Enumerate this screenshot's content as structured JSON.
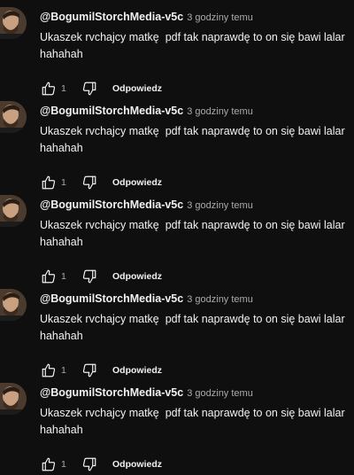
{
  "comments": [
    {
      "author": "@BogumilStorchMedia-v5c",
      "time": "3 godziny temu",
      "text_line1": "Ukaszek rvchajcy matkę  pdf tak naprawdę to on się bawi lalar",
      "text_line2": "hahahah",
      "like_count": "1",
      "reply_label": "Odpowiedz"
    },
    {
      "author": "@BogumilStorchMedia-v5c",
      "time": "3 godziny temu",
      "text_line1": "Ukaszek rvchajcy matkę  pdf tak naprawdę to on się bawi lalar",
      "text_line2": "hahahah",
      "like_count": "1",
      "reply_label": "Odpowiedz"
    },
    {
      "author": "@BogumilStorchMedia-v5c",
      "time": "3 godziny temu",
      "text_line1": "Ukaszek rvchajcy matkę  pdf tak naprawdę to on się bawi lalar",
      "text_line2": "hahahah",
      "like_count": "1",
      "reply_label": "Odpowiedz"
    },
    {
      "author": "@BogumilStorchMedia-v5c",
      "time": "3 godziny temu",
      "text_line1": "Ukaszek rvchajcy matkę  pdf tak naprawdę to on się bawi lalar",
      "text_line2": "hahahah",
      "like_count": "1",
      "reply_label": "Odpowiedz"
    },
    {
      "author": "@BogumilStorchMedia-v5c",
      "time": "3 godziny temu",
      "text_line1": "Ukaszek rvchajcy matkę  pdf tak naprawdę to on się bawi lalar",
      "text_line2": "hahahah",
      "like_count": "1",
      "reply_label": "Odpowiedz"
    }
  ],
  "icons": {
    "like": "thumbs-up-icon",
    "dislike": "thumbs-down-icon",
    "avatar": "user-avatar"
  },
  "colors": {
    "background": "#0f0f0f",
    "primary_text": "#f1f1f1",
    "secondary_text": "#aaaaaa"
  }
}
